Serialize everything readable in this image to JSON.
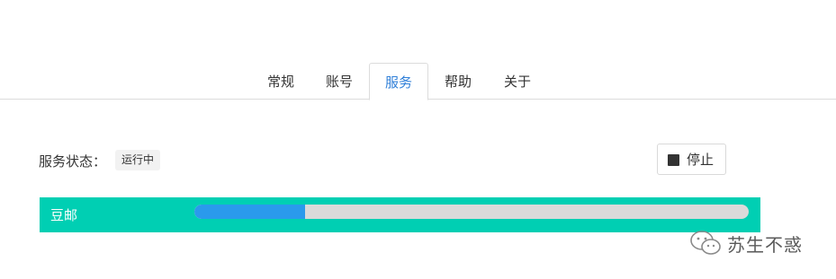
{
  "tabs": [
    {
      "label": "常规",
      "active": false
    },
    {
      "label": "账号",
      "active": false
    },
    {
      "label": "服务",
      "active": true
    },
    {
      "label": "帮助",
      "active": false
    },
    {
      "label": "关于",
      "active": false
    }
  ],
  "status": {
    "label": "服务状态：",
    "badge": "运行中"
  },
  "stop_button": {
    "icon": "stop-icon",
    "label": "停止"
  },
  "service": {
    "name": "豆邮",
    "progress": 0.2,
    "row_color": "#00cfb3",
    "progress_color": "#2a9aec"
  },
  "watermark": {
    "text": "苏生不惑",
    "icon": "wechat-logo-icon"
  }
}
